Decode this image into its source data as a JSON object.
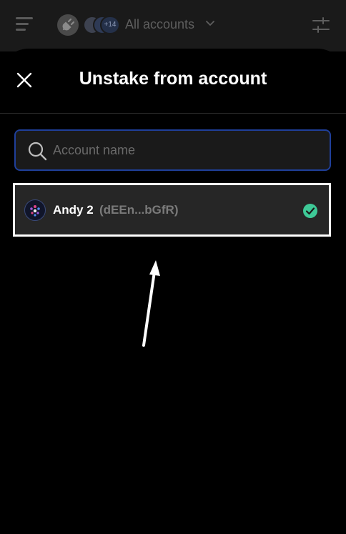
{
  "header": {
    "accounts_selector_label": "All accounts",
    "avatar_overflow_count": "+14"
  },
  "sheet": {
    "title": "Unstake from account",
    "search": {
      "placeholder": "Account name",
      "value": ""
    },
    "accounts": [
      {
        "name": "Andy 2",
        "address": "(dEEn...bGfR)",
        "selected": true
      }
    ]
  },
  "colors": {
    "background": "#000000",
    "topbar": "#1a1a1a",
    "search_border": "#1f3f9a",
    "item_background": "#262626",
    "check_green": "#3ec997",
    "highlight_border": "#ffffff"
  },
  "icons": [
    "menu-icon",
    "plug-icon",
    "chevron-down-icon",
    "filter-icon",
    "close-icon",
    "search-icon",
    "account-avatar-icon",
    "check-icon",
    "arrow-annotation"
  ]
}
